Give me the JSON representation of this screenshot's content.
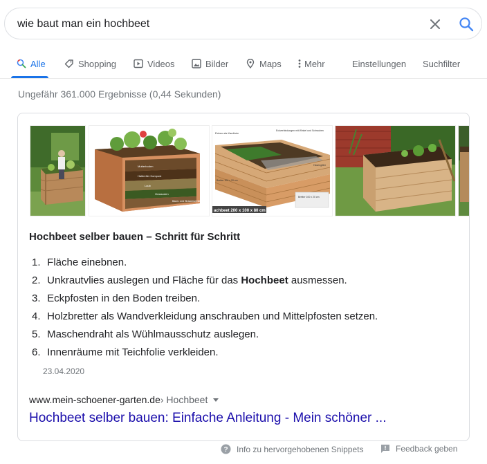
{
  "search": {
    "query": "wie baut man ein hochbeet",
    "clear_icon": "close-icon",
    "search_icon": "search-icon"
  },
  "tabs": [
    {
      "label": "Alle",
      "icon": "search-icon",
      "active": true
    },
    {
      "label": "Shopping",
      "icon": "tag-icon"
    },
    {
      "label": "Videos",
      "icon": "play-icon"
    },
    {
      "label": "Bilder",
      "icon": "image-icon"
    },
    {
      "label": "Maps",
      "icon": "map-pin-icon"
    },
    {
      "label": "Mehr",
      "icon": "more-vert-icon"
    },
    {
      "label": "Einstellungen"
    },
    {
      "label": "Suchfilter"
    }
  ],
  "result_stats": "Ungefähr 361.000 Ergebnisse (0,44 Sekunden)",
  "snippet": {
    "images": [
      {
        "name": "hochbeet-garden-photo"
      },
      {
        "name": "hochbeet-layers-diagram",
        "labels": [
          "Mutterboden",
          "Halbreifer Kompost",
          "Laub",
          "Grassoden",
          "Baum- und Strauchschnitt"
        ]
      },
      {
        "name": "hochbeet-construction-diagram",
        "labels": [
          "Ecken als Kantholz",
          "Eckverbindungen mit Winkel und Schrauben",
          "Hasengitter",
          "Bretter 100 x 20 cm",
          "Bretter 100 x 20 cm",
          "achbeet 200 x 100 x 80 cm"
        ]
      },
      {
        "name": "hochbeet-wooden-raised-bed-photo"
      },
      {
        "name": "hochbeet-partial-photo"
      }
    ],
    "title": "Hochbeet selber bauen – Schritt für Schritt",
    "steps": [
      {
        "num": "1.",
        "before": "Fläche einebnen.",
        "bold": "",
        "after": ""
      },
      {
        "num": "2.",
        "before": "Unkrautvlies auslegen und Fläche für das ",
        "bold": "Hochbeet",
        "after": " ausmessen."
      },
      {
        "num": "3.",
        "before": "Eckpfosten in den Boden treiben.",
        "bold": "",
        "after": ""
      },
      {
        "num": "4.",
        "before": "Holzbretter als Wandverkleidung anschrauben und Mittelpfosten setzen.",
        "bold": "",
        "after": ""
      },
      {
        "num": "5.",
        "before": "Maschendraht als Wühlmausschutz auslegen.",
        "bold": "",
        "after": ""
      },
      {
        "num": "6.",
        "before": "Innenräume mit Teichfolie verkleiden.",
        "bold": "",
        "after": ""
      }
    ],
    "date": "23.04.2020",
    "cite_domain": "www.mein-schoener-garten.de",
    "cite_path": " › Hochbeet",
    "link_title": "Hochbeet selber bauen: Einfache Anleitung - Mein schöner ..."
  },
  "footer": {
    "info_label": "Info zu hervorgehobenen Snippets",
    "feedback_label": "Feedback geben"
  },
  "colors": {
    "accent": "#1a73e8",
    "link": "#1a0dab",
    "muted": "#70757a"
  }
}
